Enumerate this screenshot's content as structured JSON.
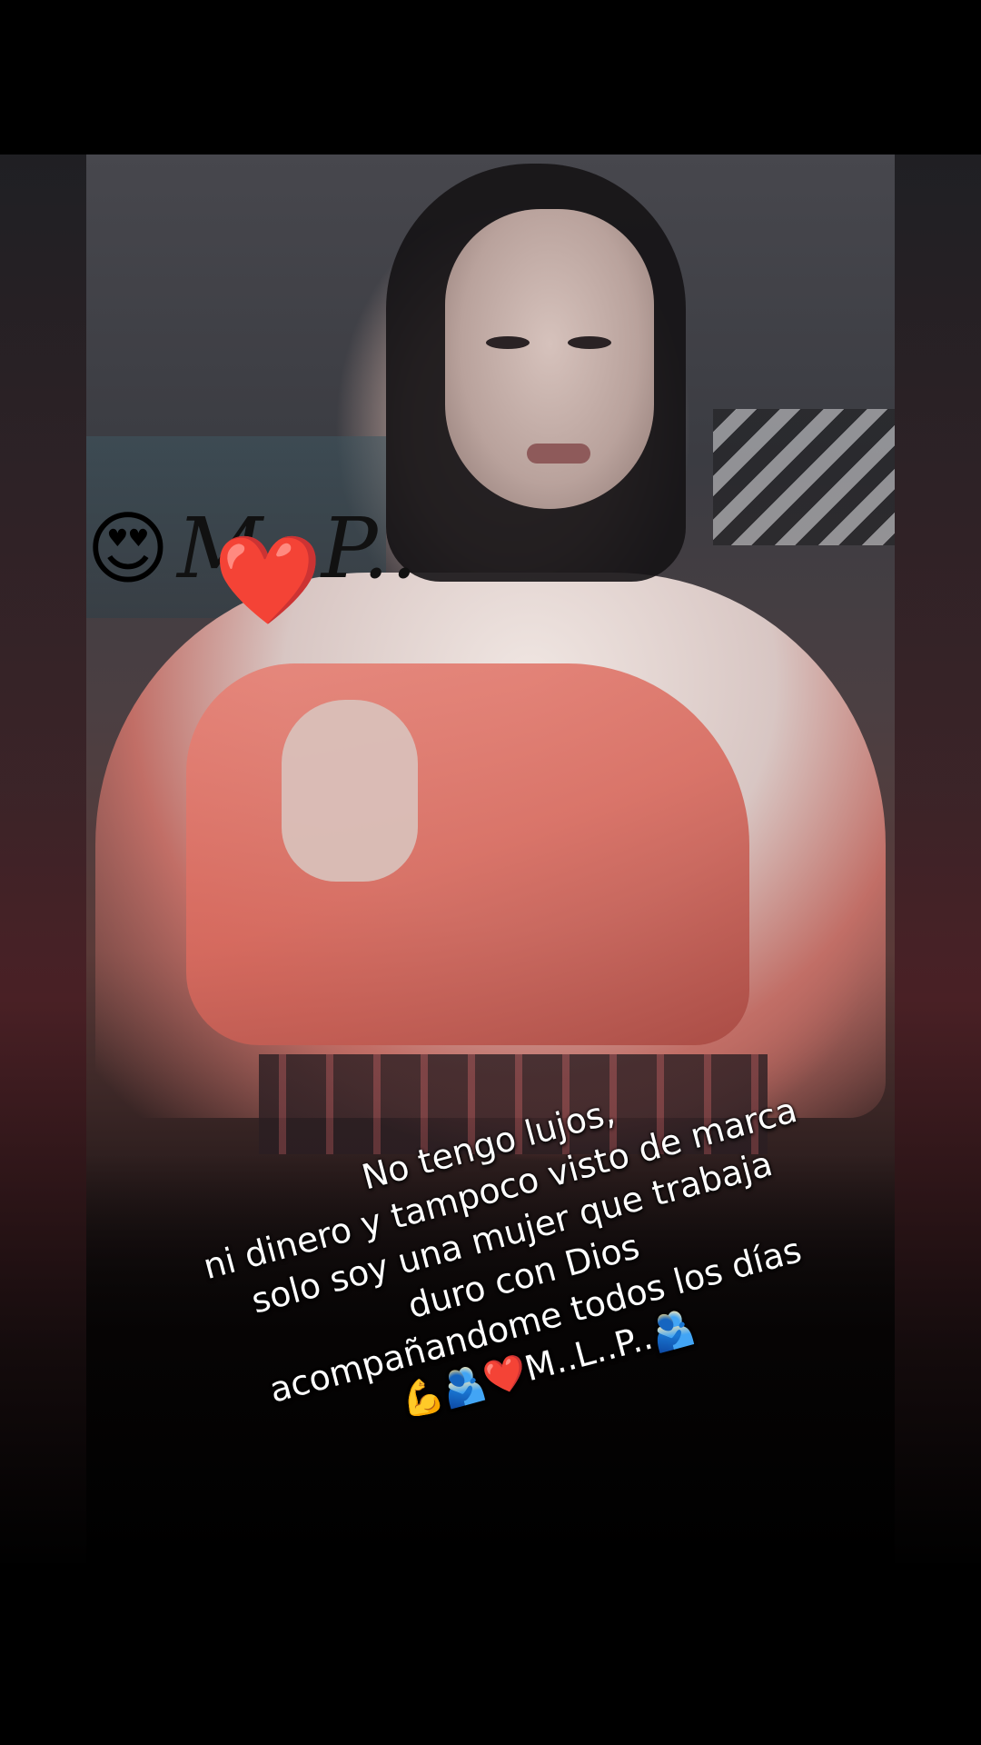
{
  "sticker": {
    "emoji_love": "😍",
    "initials": "M..P..",
    "emoji_heart": "❤️"
  },
  "caption": {
    "lines": [
      "No tengo lujos,",
      "ni dinero y tampoco visto de marca",
      "solo soy una mujer que trabaja",
      "duro con Dios",
      "acompañandome todos los días",
      "💪🫂❤️M..L..P..🫂"
    ]
  },
  "colors": {
    "background": "#000000",
    "caption_text": "#ffffff",
    "shawl": "#e07a6e"
  }
}
